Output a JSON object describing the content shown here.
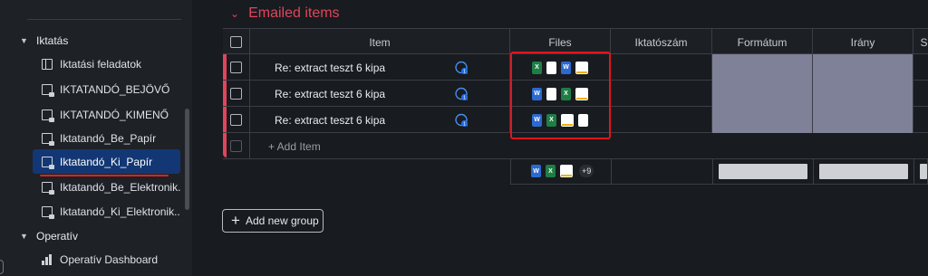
{
  "sidebar": {
    "sections": [
      {
        "label": "Iktatás",
        "expanded": true
      },
      {
        "label": "Operatív",
        "expanded": true
      }
    ],
    "items": [
      {
        "label": "Iktatási feladatok",
        "icon": "board-icon"
      },
      {
        "label": "IKTATANDÓ_BEJÖVŐ",
        "icon": "private-board-icon"
      },
      {
        "label": "IKTATANDÓ_KIMENŐ",
        "icon": "private-board-icon"
      },
      {
        "label": "Iktatandó_Be_Papír",
        "icon": "private-board-icon"
      },
      {
        "label": "Iktatandó_Ki_Papír",
        "icon": "private-board-icon",
        "active": true
      },
      {
        "label": "Iktatandó_Be_Elektronik...",
        "icon": "private-board-icon"
      },
      {
        "label": "Iktatandó_Ki_Elektronik...",
        "icon": "private-board-icon"
      },
      {
        "label": "Operatív Dashboard",
        "icon": "dashboard-icon"
      }
    ],
    "active_color": "#133774"
  },
  "group": {
    "title": "Emailed items",
    "color": "#e2445c"
  },
  "table": {
    "columns": [
      "Item",
      "Files",
      "Iktatószám",
      "Formátum",
      "Irány",
      "S"
    ],
    "rows": [
      {
        "item": "Re: extract teszt 6 kipa",
        "files": [
          "excel",
          "blank",
          "word",
          "image"
        ],
        "updates": "1"
      },
      {
        "item": "Re: extract teszt 6 kipa",
        "files": [
          "word",
          "blank",
          "excel",
          "image"
        ],
        "updates": "1"
      },
      {
        "item": "Re: extract teszt 6 kipa",
        "files": [
          "word",
          "excel",
          "image",
          "blank"
        ],
        "updates": "1"
      }
    ],
    "add_item_label": "+ Add Item",
    "summary": {
      "files": [
        "word",
        "excel",
        "image"
      ],
      "more": "+9"
    }
  },
  "add_group_label": "Add new group",
  "highlight_color": "#e0161d"
}
